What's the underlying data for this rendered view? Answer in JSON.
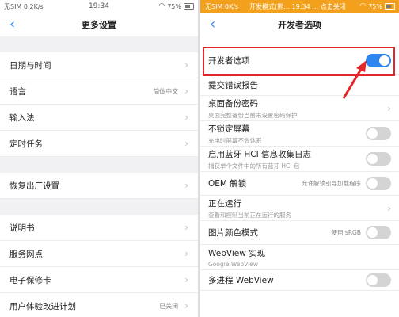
{
  "left": {
    "status": {
      "carrier": "无SIM 0.2K/s",
      "time": "19:34",
      "battery": "75%"
    },
    "title": "更多设置",
    "groups": [
      [
        {
          "label": "日期与时间",
          "value": ""
        },
        {
          "label": "语言",
          "value": "简体中文"
        },
        {
          "label": "输入法",
          "value": ""
        },
        {
          "label": "定时任务",
          "value": ""
        }
      ],
      [
        {
          "label": "恢复出厂设置",
          "value": ""
        }
      ],
      [
        {
          "label": "说明书",
          "value": ""
        },
        {
          "label": "服务网点",
          "value": ""
        },
        {
          "label": "电子保修卡",
          "value": ""
        },
        {
          "label": "用户体验改进计划",
          "value": "已关闭"
        }
      ]
    ]
  },
  "right": {
    "status": {
      "carrier": "无SIM 0K/s",
      "banner_text": "开发模式(熊… 19:34 … 点击关闭",
      "battery": "75%"
    },
    "title": "开发者选项",
    "rows": [
      {
        "label": "开发者选项",
        "sub": "",
        "value": "",
        "control": "toggle",
        "on": true
      },
      {
        "label": "提交错误报告",
        "sub": "",
        "value": "",
        "control": "none"
      },
      {
        "label": "桌面备份密码",
        "sub": "桌面完整备份当前未设置密码保护",
        "value": "",
        "control": "chevron"
      },
      {
        "label": "不锁定屏幕",
        "sub": "充电时屏幕不会休眠",
        "value": "",
        "control": "toggle",
        "on": false
      },
      {
        "label": "启用蓝牙 HCI 信息收集日志",
        "sub": "捕获单个文件中的所有蓝牙 HCI 包",
        "value": "",
        "control": "toggle",
        "on": false
      },
      {
        "label": "OEM 解锁",
        "sub": "",
        "value": "允许解锁引导加载程序",
        "control": "toggle",
        "on": false
      },
      {
        "label": "正在运行",
        "sub": "查看和控制当前正在运行的服务",
        "value": "",
        "control": "chevron"
      },
      {
        "label": "图片颜色模式",
        "sub": "",
        "value": "使用 sRGB",
        "control": "toggle",
        "on": false
      },
      {
        "label": "WebView 实现",
        "sub": "Google WebView",
        "value": "",
        "control": "none"
      },
      {
        "label": "多进程 WebView",
        "sub": "",
        "value": "",
        "control": "toggle",
        "on": false
      }
    ]
  },
  "colors": {
    "accent": "#2e87f0",
    "highlight": "#e2262a",
    "banner": "#f3a11d"
  }
}
